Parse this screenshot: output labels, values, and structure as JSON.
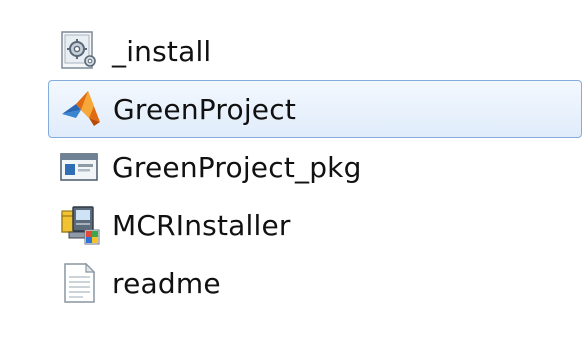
{
  "file_list": {
    "items": [
      {
        "name": "_install",
        "icon": "settings-file-icon",
        "selected": false
      },
      {
        "name": "GreenProject",
        "icon": "matlab-app-icon",
        "selected": true
      },
      {
        "name": "GreenProject_pkg",
        "icon": "application-window-icon",
        "selected": false
      },
      {
        "name": "MCRInstaller",
        "icon": "installer-icon",
        "selected": false
      },
      {
        "name": "readme",
        "icon": "text-document-icon",
        "selected": false
      }
    ]
  },
  "colors": {
    "selection_border": "#84acdd",
    "selection_fill": "#e0ecfb"
  }
}
